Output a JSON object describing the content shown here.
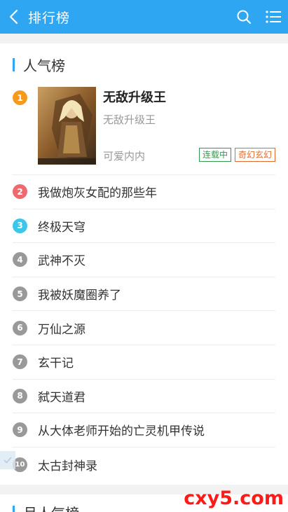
{
  "header": {
    "title": "排行榜"
  },
  "section1": {
    "title": "人气榜",
    "top_book": {
      "rank": "1",
      "title": "无敌升级王",
      "author": "无敌升级王",
      "subtitle": "可爱内内",
      "status_tag": "连载中",
      "genre_tag": "奇幻玄幻",
      "cover_icon": "book-cover-image"
    },
    "items": [
      {
        "rank": "2",
        "title": "我做炮灰女配的那些年"
      },
      {
        "rank": "3",
        "title": "终极天穹"
      },
      {
        "rank": "4",
        "title": "武神不灭"
      },
      {
        "rank": "5",
        "title": "我被妖魔圈养了"
      },
      {
        "rank": "6",
        "title": "万仙之源"
      },
      {
        "rank": "7",
        "title": "玄干记"
      },
      {
        "rank": "8",
        "title": "弑天道君"
      },
      {
        "rank": "9",
        "title": "从大体老师开始的亡灵机甲传说"
      },
      {
        "rank": "10",
        "title": "太古封神录"
      }
    ]
  },
  "section2": {
    "title": "月人气榜"
  },
  "watermark": "cxy5.com",
  "colors": {
    "primary": "#2ea6f2",
    "rank1": "#f59a1b",
    "rank2": "#ef6a6e",
    "rank3": "#3cc7ea",
    "rank_other": "#999999",
    "tag_green": "#2e9b4e",
    "tag_orange": "#e46b2b",
    "watermark": "#ff1a1a"
  },
  "icons": [
    "back-arrow-icon",
    "search-icon",
    "menu-list-icon"
  ]
}
